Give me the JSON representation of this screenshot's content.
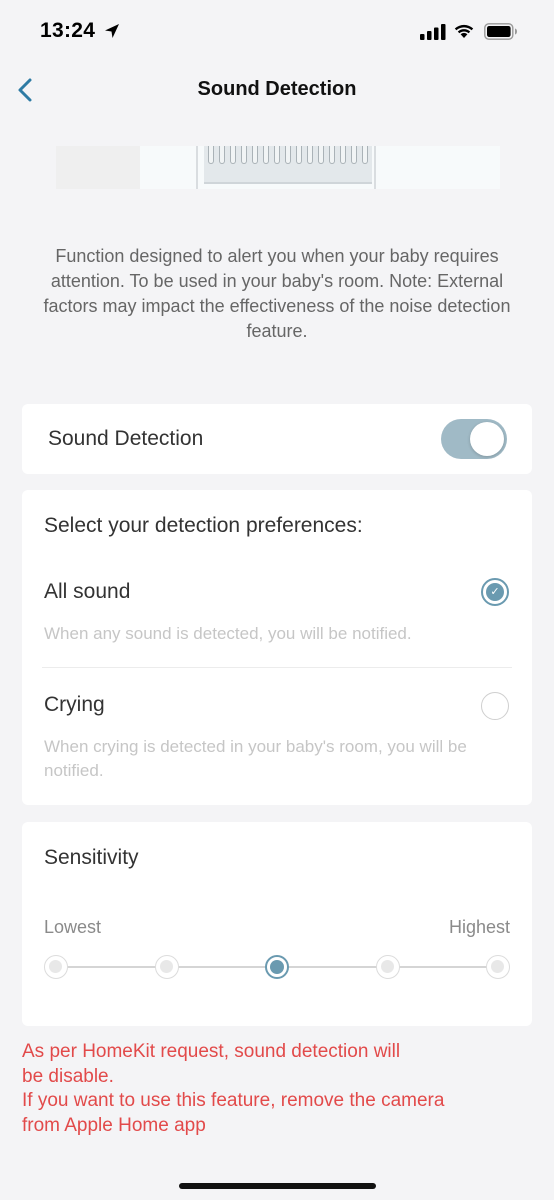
{
  "status_bar": {
    "time": "13:24"
  },
  "nav": {
    "title": "Sound Detection"
  },
  "description": "Function designed to alert you when your baby requires attention. To be used in your baby's room. Note: External factors may impact the effectiveness of the noise detection feature.",
  "sound_detection": {
    "label": "Sound Detection",
    "enabled": true
  },
  "preferences": {
    "heading": "Select your detection preferences:",
    "options": [
      {
        "label": "All sound",
        "description": "When any sound is detected, you will be notified.",
        "selected": true
      },
      {
        "label": "Crying",
        "description": "When crying is detected in your baby's room, you will be notified.",
        "selected": false
      }
    ]
  },
  "sensitivity": {
    "heading": "Sensitivity",
    "low_label": "Lowest",
    "high_label": "Highest",
    "levels": 5,
    "selected_level": 3
  },
  "warning": "As per HomeKit request, sound detection will\nbe disable.\n If you want to use this feature, remove the camera\nfrom Apple Home app",
  "colors": {
    "accent": "#6a9ab0",
    "toggle_on": "#a0bac6",
    "warning": "#e24a4a",
    "background": "#f4f4f6"
  }
}
